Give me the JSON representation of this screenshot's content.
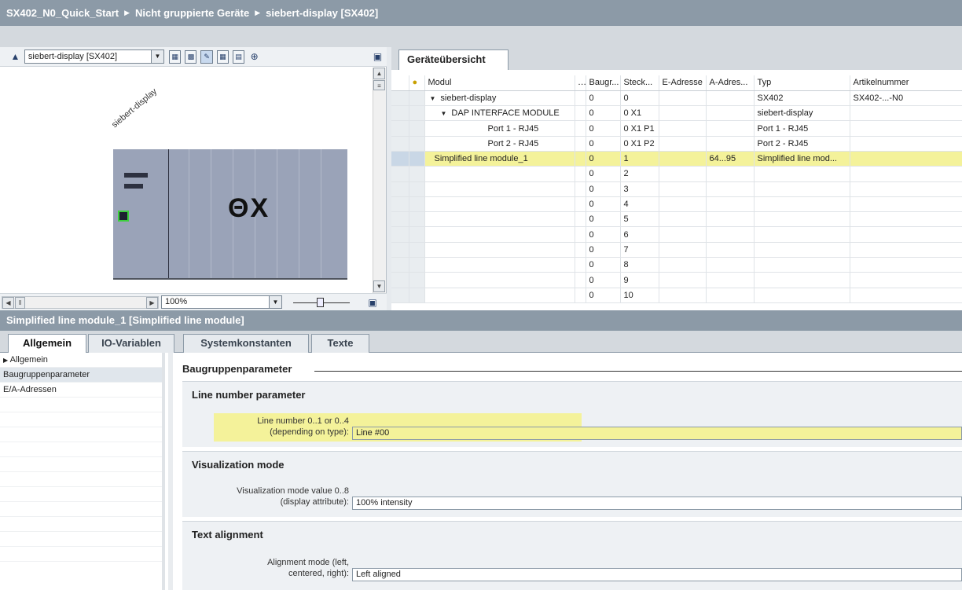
{
  "breadcrumb": {
    "project": "SX402_N0_Quick_Start",
    "group": "Nicht gruppierte Geräte",
    "device": "siebert-display [SX402]"
  },
  "device_view": {
    "selected_device": "siebert-display [SX402]",
    "device_label": "siebert-display",
    "zoom_value": "100%",
    "logo_text": "ΘX"
  },
  "overview": {
    "tab_label": "Geräteübersicht",
    "columns": [
      "Modul",
      "...",
      "Baugr...",
      "Steck...",
      "E-Adresse",
      "A-Adres...",
      "Typ",
      "Artikelnummer"
    ],
    "rows": [
      {
        "modul": "siebert-display",
        "indent": 1,
        "expander": "▼",
        "baugr": "0",
        "steck": "0",
        "e_adr": "",
        "a_adr": "",
        "typ": "SX402",
        "artikel": "SX402-...-N0",
        "selected": false
      },
      {
        "modul": "DAP INTERFACE MODULE",
        "indent": 2,
        "expander": "▼",
        "baugr": "0",
        "steck": "0 X1",
        "e_adr": "",
        "a_adr": "",
        "typ": "siebert-display",
        "artikel": "",
        "selected": false
      },
      {
        "modul": "Port 1 - RJ45",
        "indent": 3,
        "expander": "",
        "baugr": "0",
        "steck": "0 X1 P1",
        "e_adr": "",
        "a_adr": "",
        "typ": "Port 1 - RJ45",
        "artikel": "",
        "selected": false
      },
      {
        "modul": "Port 2 - RJ45",
        "indent": 3,
        "expander": "",
        "baugr": "0",
        "steck": "0 X1 P2",
        "e_adr": "",
        "a_adr": "",
        "typ": "Port 2 - RJ45",
        "artikel": "",
        "selected": false
      },
      {
        "modul": "Simplified line module_1",
        "indent": 1,
        "expander": "",
        "baugr": "0",
        "steck": "1",
        "e_adr": "",
        "a_adr": "64...95",
        "typ": "Simplified line mod...",
        "artikel": "",
        "selected": true
      },
      {
        "modul": "",
        "indent": 0,
        "expander": "",
        "baugr": "0",
        "steck": "2",
        "e_adr": "",
        "a_adr": "",
        "typ": "",
        "artikel": "",
        "selected": false
      },
      {
        "modul": "",
        "indent": 0,
        "expander": "",
        "baugr": "0",
        "steck": "3",
        "e_adr": "",
        "a_adr": "",
        "typ": "",
        "artikel": "",
        "selected": false
      },
      {
        "modul": "",
        "indent": 0,
        "expander": "",
        "baugr": "0",
        "steck": "4",
        "e_adr": "",
        "a_adr": "",
        "typ": "",
        "artikel": "",
        "selected": false
      },
      {
        "modul": "",
        "indent": 0,
        "expander": "",
        "baugr": "0",
        "steck": "5",
        "e_adr": "",
        "a_adr": "",
        "typ": "",
        "artikel": "",
        "selected": false
      },
      {
        "modul": "",
        "indent": 0,
        "expander": "",
        "baugr": "0",
        "steck": "6",
        "e_adr": "",
        "a_adr": "",
        "typ": "",
        "artikel": "",
        "selected": false
      },
      {
        "modul": "",
        "indent": 0,
        "expander": "",
        "baugr": "0",
        "steck": "7",
        "e_adr": "",
        "a_adr": "",
        "typ": "",
        "artikel": "",
        "selected": false
      },
      {
        "modul": "",
        "indent": 0,
        "expander": "",
        "baugr": "0",
        "steck": "8",
        "e_adr": "",
        "a_adr": "",
        "typ": "",
        "artikel": "",
        "selected": false
      },
      {
        "modul": "",
        "indent": 0,
        "expander": "",
        "baugr": "0",
        "steck": "9",
        "e_adr": "",
        "a_adr": "",
        "typ": "",
        "artikel": "",
        "selected": false
      },
      {
        "modul": "",
        "indent": 0,
        "expander": "",
        "baugr": "0",
        "steck": "10",
        "e_adr": "",
        "a_adr": "",
        "typ": "",
        "artikel": "",
        "selected": false
      }
    ]
  },
  "properties": {
    "title": "Simplified line module_1 [Simplified line module]",
    "tabs": [
      "Allgemein",
      "IO-Variablen",
      "Systemkonstanten",
      "Texte"
    ],
    "nav": [
      "Allgemein",
      "Baugruppenparameter",
      "E/A-Adressen"
    ],
    "section_title": "Baugruppenparameter",
    "groups": [
      {
        "title": "Line number parameter",
        "label_line1": "Line number 0..1 or 0..4",
        "label_line2": "(depending on type):",
        "value": "Line #00"
      },
      {
        "title": "Visualization mode",
        "label_line1": "Visualization mode value 0..8",
        "label_line2": "(display attribute):",
        "value": "100% intensity"
      },
      {
        "title": "Text alignment",
        "label_line1": "Alignment mode (left,",
        "label_line2": "centered, right):",
        "value": "Left aligned"
      }
    ]
  },
  "colors": {
    "header_bar": "#8c9aa7",
    "highlight": "#f4f29a",
    "module_body": "#9aa3b8",
    "port_led": "#3cd03c"
  }
}
